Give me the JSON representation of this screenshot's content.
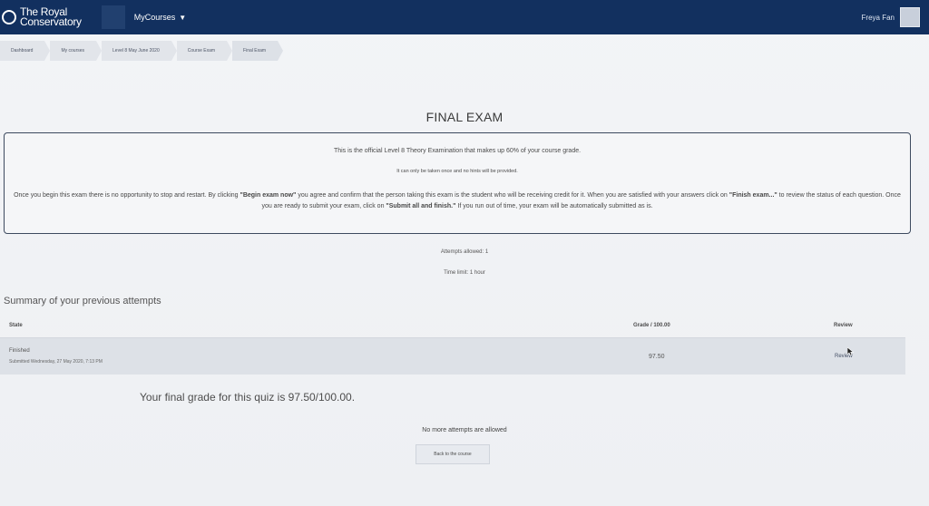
{
  "navbar": {
    "brand_line1": "The Royal",
    "brand_line2": "Conservatory",
    "my_courses": "MyCourses",
    "username": "Freya Fan"
  },
  "breadcrumb": [
    "Dashboard",
    "My courses",
    "Level 8 May June 2020",
    "Course Exam",
    "Final Exam"
  ],
  "exam": {
    "title": "FINAL EXAM",
    "line1": "This is the official Level 8 Theory Examination that makes up 60% of your course grade.",
    "line2": "It can only be taken once and no hints will be provided.",
    "para_part1": "Once you begin this exam there is no opportunity to stop and restart. By clicking ",
    "para_begin": "\"Begin exam now\"",
    "para_part2": " you agree and confirm that the person taking this exam is the student who will be receiving credit for it. When you are satisfied with your answers click on ",
    "para_finish": "\"Finish exam...\"",
    "para_part3": " to review the status of each question. Once you are ready to submit your exam, click on ",
    "para_submit": "\"Submit all and finish.\"",
    "para_part4": " If you run out of time, your exam will be automatically submitted as is.",
    "attempts_allowed": "Attempts allowed: 1",
    "time_limit": "Time limit: 1 hour",
    "summary_title": "Summary of your previous attempts",
    "table": {
      "headers": {
        "state": "State",
        "grade": "Grade / 100.00",
        "review": "Review"
      },
      "row": {
        "state_main": "Finished",
        "state_sub": "Submitted Wednesday, 27 May 2020, 7:13 PM",
        "grade": "97.50",
        "review": "Review"
      }
    },
    "final_grade": "Your final grade for this quiz is 97.50/100.00.",
    "no_attempts": "No more attempts are allowed",
    "back_button": "Back to the course"
  }
}
